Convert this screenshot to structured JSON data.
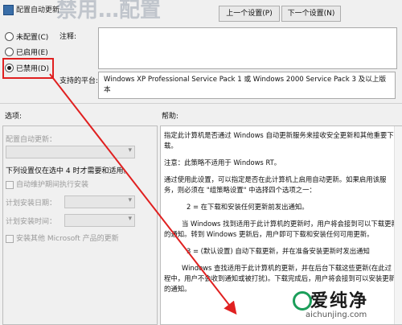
{
  "window": {
    "title": "配置自动更新",
    "blurred_heading": "禁用…配置"
  },
  "nav": {
    "prev_label": "上一个设置(P)",
    "next_label": "下一个设置(N)"
  },
  "state_options": [
    {
      "label": "未配置(C)",
      "selected": false
    },
    {
      "label": "已启用(E)",
      "selected": false
    },
    {
      "label": "已禁用(D)",
      "selected": true
    }
  ],
  "comment": {
    "label": "注释:",
    "value": ""
  },
  "platform": {
    "label": "支持的平台:",
    "value": "Windows XP Professional Service Pack 1 或 Windows 2000 Service Pack 3 及以上版本"
  },
  "sections": {
    "options_label": "选项:",
    "help_label": "帮助:"
  },
  "options": {
    "configure_label": "配置自动更新：",
    "note": "下列设置仅在选中 4 时才需要和适用。",
    "maintenance_checkbox": "自动维护期间执行安装",
    "schedule_day_label": "计划安装日期：",
    "schedule_time_label": "计划安装时间：",
    "other_products_checkbox": "安装其他 Microsoft 产品的更新"
  },
  "help": {
    "paragraphs": [
      "指定此计算机是否通过 Windows 自动更新服务来接收安全更新和其他重要下载。",
      "注意：此策略不适用于 Windows RT。",
      "通过使用此设置，可以指定是否在此计算机上启用自动更新。如果启用该服务，则必须在 \"组策略设置\" 中选择四个选项之一：",
      "2 = 在下载和安装任何更新前发出通知。",
      "当 Windows 找到适用于此计算机的更新时，用户将会接到可以下载更新的通知。转到 Windows 更新后，用户即可下载和安装任何可用更新。",
      "3 = (默认设置) 自动下载更新，并在准备安装更新时发出通知",
      "Windows 查找适用于此计算机的更新，并在后台下载这些更新(在此过程中，用户不会收到通知或被打扰)。下载完成后，用户将会接到可以安装更新的通知。"
    ]
  },
  "watermark": {
    "zh": "爱纯净",
    "en": "aichunjing.com",
    "color": "#1b9e5a"
  },
  "annotation": {
    "color": "#e02020"
  }
}
